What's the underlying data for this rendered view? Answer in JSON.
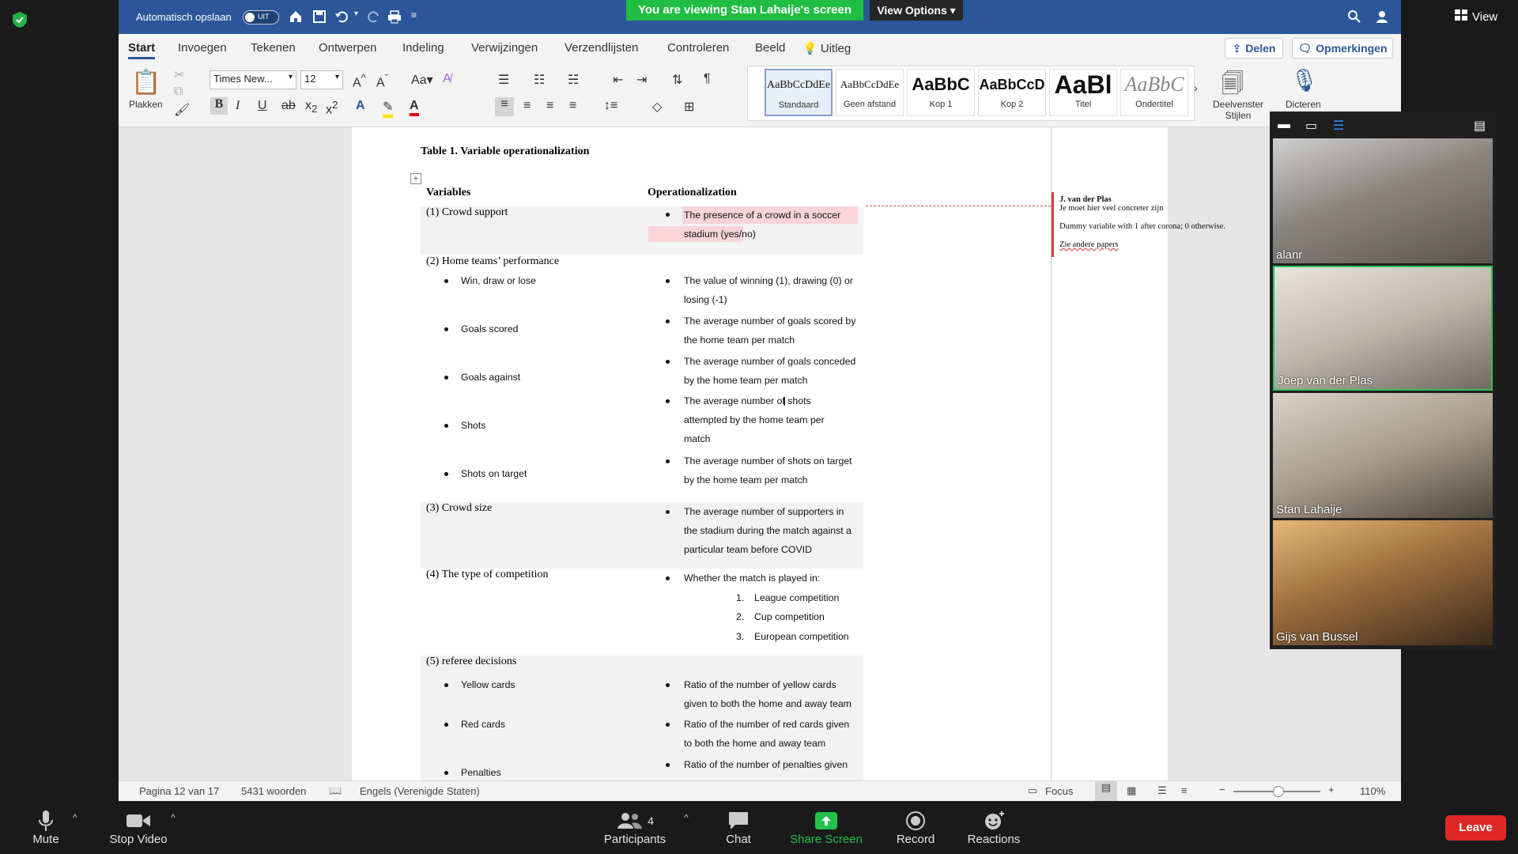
{
  "zoom": {
    "view_label": "View",
    "banner": "You are viewing Stan Lahaije's screen",
    "view_options": "View Options",
    "participants_count": "4",
    "bottom": {
      "mute": "Mute",
      "stop_video": "Stop Video",
      "participants": "Participants",
      "chat": "Chat",
      "share_screen": "Share Screen",
      "record": "Record",
      "reactions": "Reactions",
      "leave": "Leave"
    },
    "tiles": [
      {
        "name": "alanr"
      },
      {
        "name": "Joep van der Plas"
      },
      {
        "name": "Stan Lahaije"
      },
      {
        "name": "Gijs van Bussel"
      }
    ]
  },
  "word": {
    "autosave_label": "Automatisch opslaan",
    "autosave_state": "UIT",
    "tabs": [
      "Start",
      "Invoegen",
      "Tekenen",
      "Ontwerpen",
      "Indeling",
      "Verwijzingen",
      "Verzendlijsten",
      "Controleren",
      "Beeld",
      "Uitleg"
    ],
    "share_label": "Delen",
    "comments_label": "Opmerkingen",
    "ribbon": {
      "paste_label": "Plakken",
      "font_name": "Times New...",
      "font_size": "12",
      "styles": [
        {
          "preview": "AaBbCcDdEe",
          "name": "Standaard"
        },
        {
          "preview": "AaBbCcDdEe",
          "name": "Geen afstand"
        },
        {
          "preview": "AaBbC",
          "name": "Kop 1"
        },
        {
          "preview": "AaBbCcD",
          "name": "Kop 2"
        },
        {
          "preview": "AaBl",
          "name": "Titel"
        },
        {
          "preview": "AaBbC",
          "name": "Ondertitel"
        }
      ],
      "pane_label_1": "Deelvenster",
      "pane_label_2": "Stijlen",
      "dictate_label": "Dicteren"
    },
    "document": {
      "table_title": "Table 1. Variable operationalization",
      "col_variables": "Variables",
      "col_operationalization": "Operationalization",
      "v1": "(1) Crowd support",
      "v1_op_a": "The presence of a crowd in a soccer",
      "v1_op_b": "stadium (yes/no)",
      "v2": "(2)  Home teams’ performance",
      "v2_items": [
        "Win, draw or lose",
        "Goals scored",
        "Goals against",
        "Shots",
        "Shots on target"
      ],
      "v2_ops": [
        [
          "The value of winning (1), drawing (0) or",
          "losing (-1)"
        ],
        [
          "The average number of goals scored by",
          "the home team per match"
        ],
        [
          "The average number of goals conceded",
          "by the home team per match"
        ],
        [
          "The average number of shots",
          "attempted by the home team per",
          "match"
        ],
        [
          "The average number of shots on target",
          "by the home team per match"
        ]
      ],
      "v3": "(3) Crowd size",
      "v3_op": [
        "The average number of supporters in",
        "the stadium during the match against a",
        "particular team before COVID"
      ],
      "v4": "(4) The type of competition",
      "v4_op": "Whether the match is played in:",
      "v4_list": [
        "League competition",
        "Cup competition",
        "European competition"
      ],
      "v4_nums": [
        "1.",
        "2.",
        "3."
      ],
      "v5": "(5) referee decisions",
      "v5_items": [
        "Yellow cards",
        "Red cards",
        "Penalties"
      ],
      "v5_ops": [
        [
          "Ratio of the number of yellow cards",
          "given to both the home and away team"
        ],
        [
          "Ratio of the number of red cards given",
          "to both the home and away team"
        ],
        [
          "Ratio of the number of penalties given"
        ]
      ]
    },
    "comment": {
      "author": "J. van der Plas",
      "line1": "Je moet hier veel concreter zijn",
      "line2": "Dummy variable with 1 after corona; 0 otherwise.",
      "line3": "Zie andere papers"
    },
    "status": {
      "page": "Pagina 12 van 17",
      "words": "5431 woorden",
      "language": "Engels (Verenigde Staten)",
      "focus": "Focus",
      "zoom": "110%"
    }
  }
}
